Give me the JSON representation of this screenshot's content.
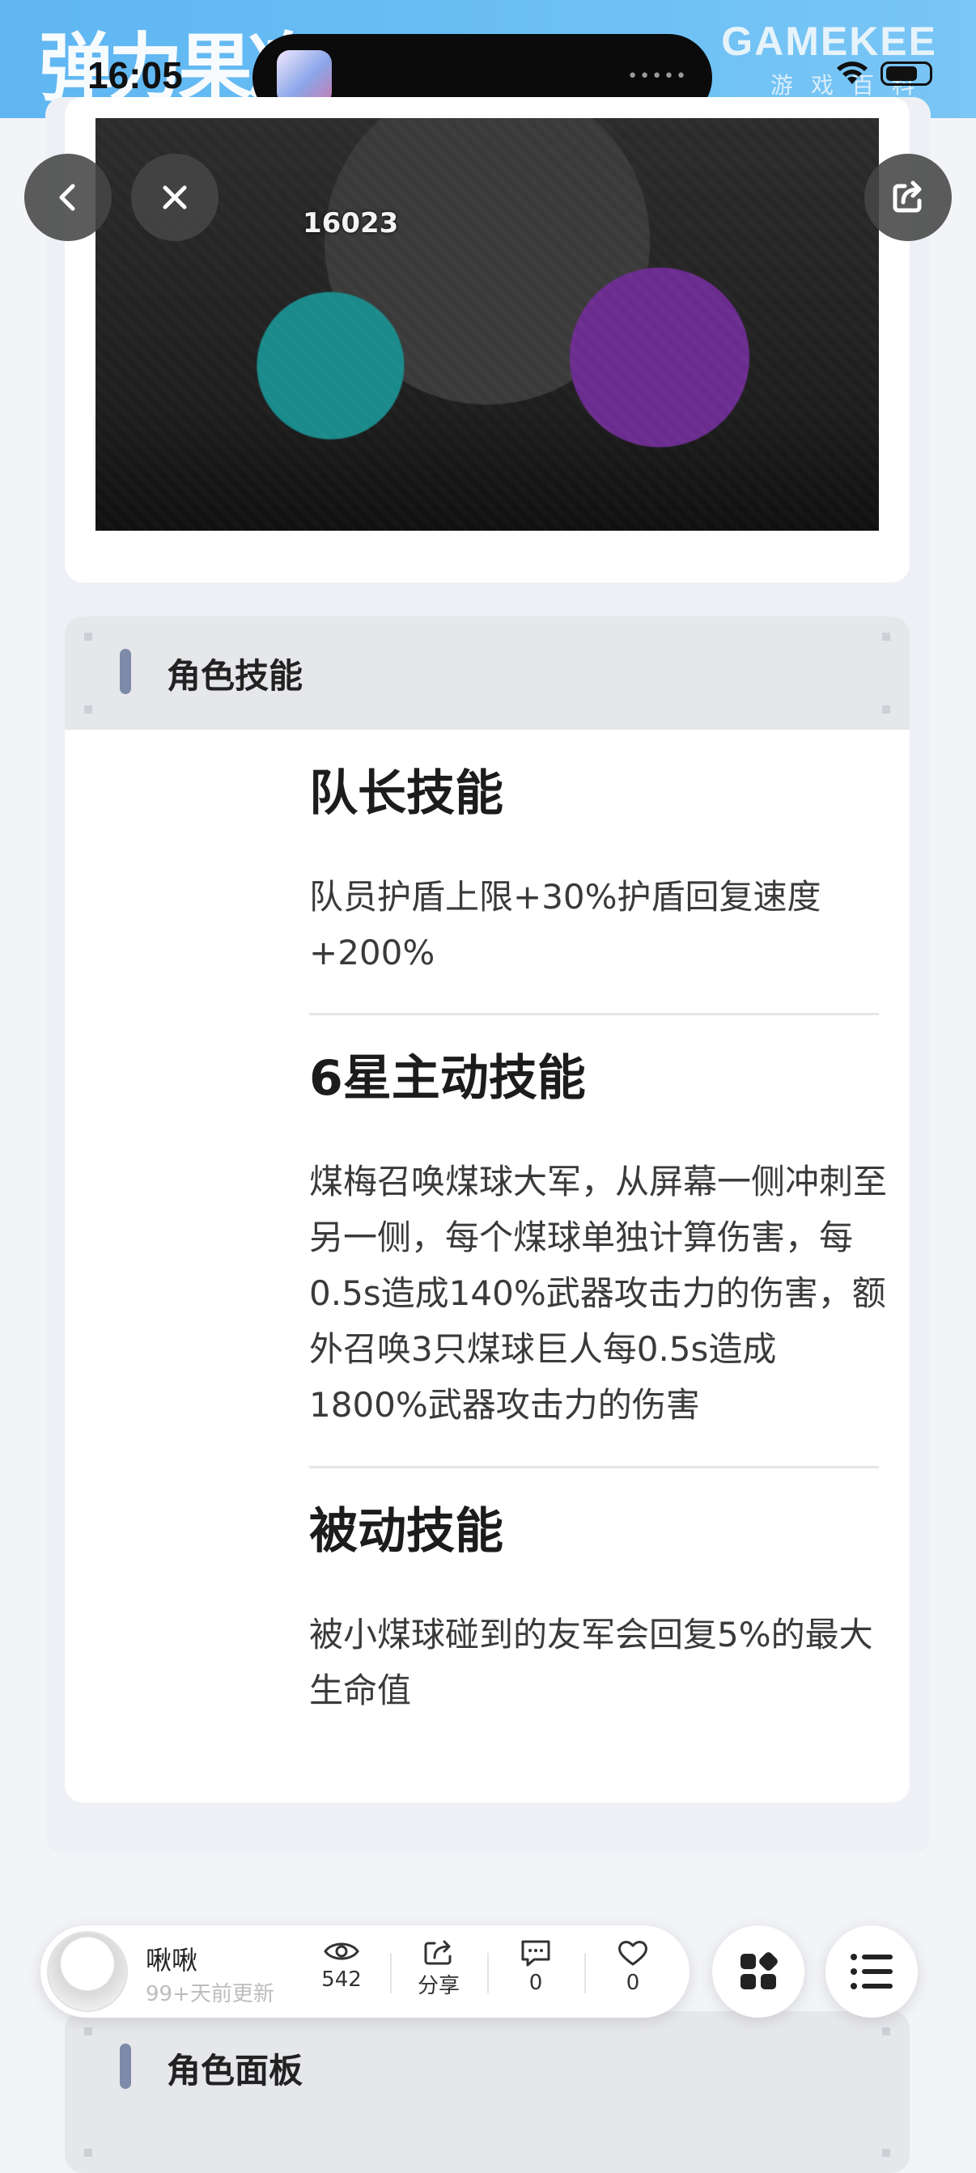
{
  "status_bar": {
    "time": "16:05"
  },
  "header": {
    "logo_text": "弹力果冻",
    "brand": "GAMEKEE",
    "brand_sub": "游戏百科"
  },
  "video": {
    "hud_text": "16023"
  },
  "skills_section": {
    "title": "角色技能",
    "skills": [
      {
        "name": "队长技能",
        "desc": "队员护盾上限+30%护盾回复速度+200%"
      },
      {
        "name": "6星主动技能",
        "desc": "煤梅召唤煤球大军，从屏幕一侧冲刺至另一侧，每个煤球单独计算伤害，每0.5s造成140%武器攻击力的伤害，额外召唤3只煤球巨人每0.5s造成1800%武器攻击力的伤害"
      },
      {
        "name": "被动技能",
        "desc": "被小煤球碰到的友军会回复5%的最大生命值"
      }
    ]
  },
  "bottom_bar": {
    "author": "啾啾",
    "updated": "99+天前更新",
    "views": "542",
    "share_label": "分享",
    "comments": "0",
    "likes": "0"
  },
  "panel_section": {
    "title": "角色面板"
  },
  "colors": {
    "header_bg": "#6cc0f5",
    "accent_bar": "#7e8aa9"
  }
}
